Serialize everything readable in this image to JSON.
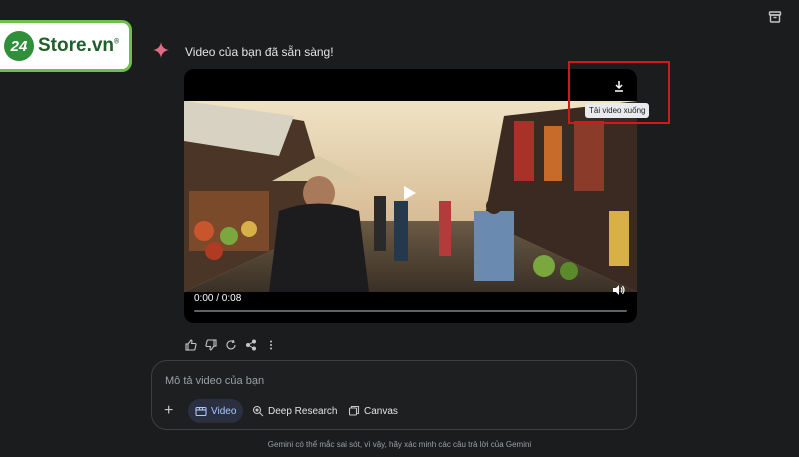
{
  "brand": {
    "badge": "24",
    "name": "Store.vn",
    "reg": "®"
  },
  "response": {
    "title": "Video của bạn đã sẵn sàng!"
  },
  "video": {
    "time": "0:00 / 0:08",
    "progress": 0.0,
    "download_tooltip": "Tải video xuống"
  },
  "actions": [
    "thumb-up-icon",
    "thumb-down-icon",
    "regenerate-icon",
    "share-icon",
    "more-vert-icon"
  ],
  "composer": {
    "placeholder": "Mô tả video của bạn",
    "tools": [
      {
        "label": "Video",
        "icon": "video-icon",
        "active": true
      },
      {
        "label": "Deep Research",
        "icon": "deep-research-icon",
        "active": false
      },
      {
        "label": "Canvas",
        "icon": "canvas-icon",
        "active": false
      }
    ]
  },
  "disclaimer": "Gemini có thể mắc sai sót, vì vậy, hãy xác minh các câu trả lời của Gemini",
  "colors": {
    "background": "#1b1c1d",
    "accent": "#a8c7fa",
    "highlight": "#d0191d",
    "spark": "#e06b84"
  }
}
